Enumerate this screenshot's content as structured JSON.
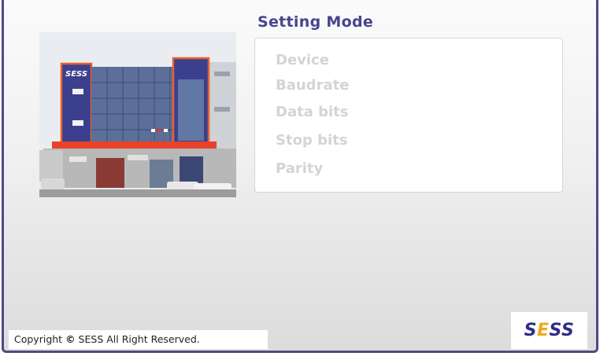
{
  "header": {
    "title": "Setting Mode"
  },
  "photo": {
    "sign_text": "SESS"
  },
  "menu": {
    "items": [
      {
        "label": "Device"
      },
      {
        "label": "Baudrate"
      },
      {
        "label": "Data bits"
      },
      {
        "label": "Stop bits"
      },
      {
        "label": "Parity"
      }
    ]
  },
  "footer": {
    "copyright_prefix": "Copyright",
    "copyright_symbol": "©",
    "copyright_text": "SESS All Right Reserved.",
    "logo_s1": "S",
    "logo_e": "E",
    "logo_ss": "SS"
  },
  "colors": {
    "frame": "#4e4a86",
    "title": "#474590",
    "menu_text": "#d4d4d4",
    "logo_blue": "#2e2e84",
    "logo_orange": "#f2a81d"
  }
}
